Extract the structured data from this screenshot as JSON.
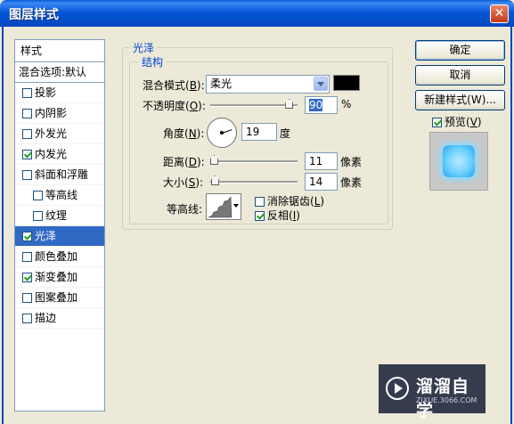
{
  "window": {
    "title": "图层样式",
    "close_glyph": "✕"
  },
  "style_list": {
    "header": "样式",
    "blend_defaults": "混合选项:默认",
    "items": [
      {
        "label": "投影",
        "checked": false
      },
      {
        "label": "内阴影",
        "checked": false
      },
      {
        "label": "外发光",
        "checked": false
      },
      {
        "label": "内发光",
        "checked": true
      },
      {
        "label": "斜面和浮雕",
        "checked": false
      },
      {
        "label": "等高线",
        "checked": false,
        "indent": true
      },
      {
        "label": "纹理",
        "checked": false,
        "indent": true
      },
      {
        "label": "光泽",
        "checked": true,
        "selected": true
      },
      {
        "label": "颜色叠加",
        "checked": false
      },
      {
        "label": "渐变叠加",
        "checked": true
      },
      {
        "label": "图案叠加",
        "checked": false
      },
      {
        "label": "描边",
        "checked": false
      }
    ]
  },
  "panel": {
    "group_title": "光泽",
    "structure_title": "结构",
    "blend_mode": {
      "label": "混合模式(",
      "key": "B",
      "label_end": "):",
      "value": "柔光",
      "color": "#000000"
    },
    "opacity": {
      "label": "不透明度(",
      "key": "O",
      "label_end": "):",
      "value": "90",
      "unit": "%",
      "level": 0.9
    },
    "angle": {
      "label": "角度(",
      "key": "N",
      "label_end": "):",
      "value": "19",
      "unit": "度"
    },
    "distance": {
      "label": "距离(",
      "key": "D",
      "label_end": "):",
      "value": "11",
      "unit": "像素",
      "level": 0.04
    },
    "size": {
      "label": "大小(",
      "key": "S",
      "label_end": "):",
      "value": "14",
      "unit": "像素",
      "level": 0.05
    },
    "contour": {
      "label": "等高线:"
    },
    "anti_alias": {
      "label": "消除锯齿(",
      "key": "L",
      "label_end": ")",
      "checked": false
    },
    "invert": {
      "label": "反相(",
      "key": "I",
      "label_end": ")",
      "checked": true
    }
  },
  "buttons": {
    "ok": "确定",
    "cancel": "取消",
    "new_style": "新建样式(W)...",
    "preview": {
      "label": "预览(",
      "key": "V",
      "label_end": ")",
      "checked": true
    }
  },
  "watermark": {
    "title": "溜溜自学",
    "sub": "ZIXUE.3066.COM"
  }
}
